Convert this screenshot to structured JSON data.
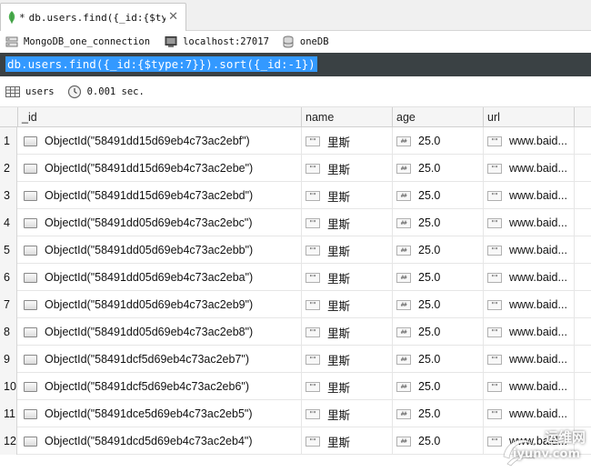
{
  "tab": {
    "modified_marker": "*",
    "title": "db.users.find({_id:{$ty···",
    "close_glyph": "✕",
    "icon": "mongodb-leaf-icon"
  },
  "connection": {
    "name": "MongoDB_one_connection",
    "host": "localhost:27017",
    "database": "oneDB",
    "icons": [
      "server-icon",
      "monitor-icon",
      "database-icon"
    ]
  },
  "query": {
    "text": "db.users.find({_id:{$type:7}}).sort({_id:-1})"
  },
  "result": {
    "collection": "users",
    "time": "0.001 sec.",
    "icons": [
      "table-icon",
      "clock-icon"
    ]
  },
  "grid": {
    "columns": [
      "_id",
      "name",
      "age",
      "url"
    ],
    "type_icons": {
      "string": "\"\"",
      "number": "##"
    },
    "rows": [
      {
        "num": "1",
        "id": "ObjectId(\"58491dd15d69eb4c73ac2ebf\")",
        "name": "里斯",
        "age": "25.0",
        "url": "www.baid..."
      },
      {
        "num": "2",
        "id": "ObjectId(\"58491dd15d69eb4c73ac2ebe\")",
        "name": "里斯",
        "age": "25.0",
        "url": "www.baid..."
      },
      {
        "num": "3",
        "id": "ObjectId(\"58491dd15d69eb4c73ac2ebd\")",
        "name": "里斯",
        "age": "25.0",
        "url": "www.baid..."
      },
      {
        "num": "4",
        "id": "ObjectId(\"58491dd05d69eb4c73ac2ebc\")",
        "name": "里斯",
        "age": "25.0",
        "url": "www.baid..."
      },
      {
        "num": "5",
        "id": "ObjectId(\"58491dd05d69eb4c73ac2ebb\")",
        "name": "里斯",
        "age": "25.0",
        "url": "www.baid..."
      },
      {
        "num": "6",
        "id": "ObjectId(\"58491dd05d69eb4c73ac2eba\")",
        "name": "里斯",
        "age": "25.0",
        "url": "www.baid..."
      },
      {
        "num": "7",
        "id": "ObjectId(\"58491dd05d69eb4c73ac2eb9\")",
        "name": "里斯",
        "age": "25.0",
        "url": "www.baid..."
      },
      {
        "num": "8",
        "id": "ObjectId(\"58491dd05d69eb4c73ac2eb8\")",
        "name": "里斯",
        "age": "25.0",
        "url": "www.baid..."
      },
      {
        "num": "9",
        "id": "ObjectId(\"58491dcf5d69eb4c73ac2eb7\")",
        "name": "里斯",
        "age": "25.0",
        "url": "www.baid..."
      },
      {
        "num": "10",
        "id": "ObjectId(\"58491dcf5d69eb4c73ac2eb6\")",
        "name": "里斯",
        "age": "25.0",
        "url": "www.baid..."
      },
      {
        "num": "11",
        "id": "ObjectId(\"58491dce5d69eb4c73ac2eb5\")",
        "name": "里斯",
        "age": "25.0",
        "url": "www.baid..."
      },
      {
        "num": "12",
        "id": "ObjectId(\"58491dcd5d69eb4c73ac2eb4\")",
        "name": "里斯",
        "age": "25.0",
        "url": "www.baid..."
      }
    ]
  },
  "watermark": {
    "top": "运维网",
    "bottom": "iyunv.com"
  },
  "colors": {
    "accent_selection": "#3399ff",
    "query_bar_bg": "#3a4144",
    "mongodb_leaf": "#4caf50"
  }
}
